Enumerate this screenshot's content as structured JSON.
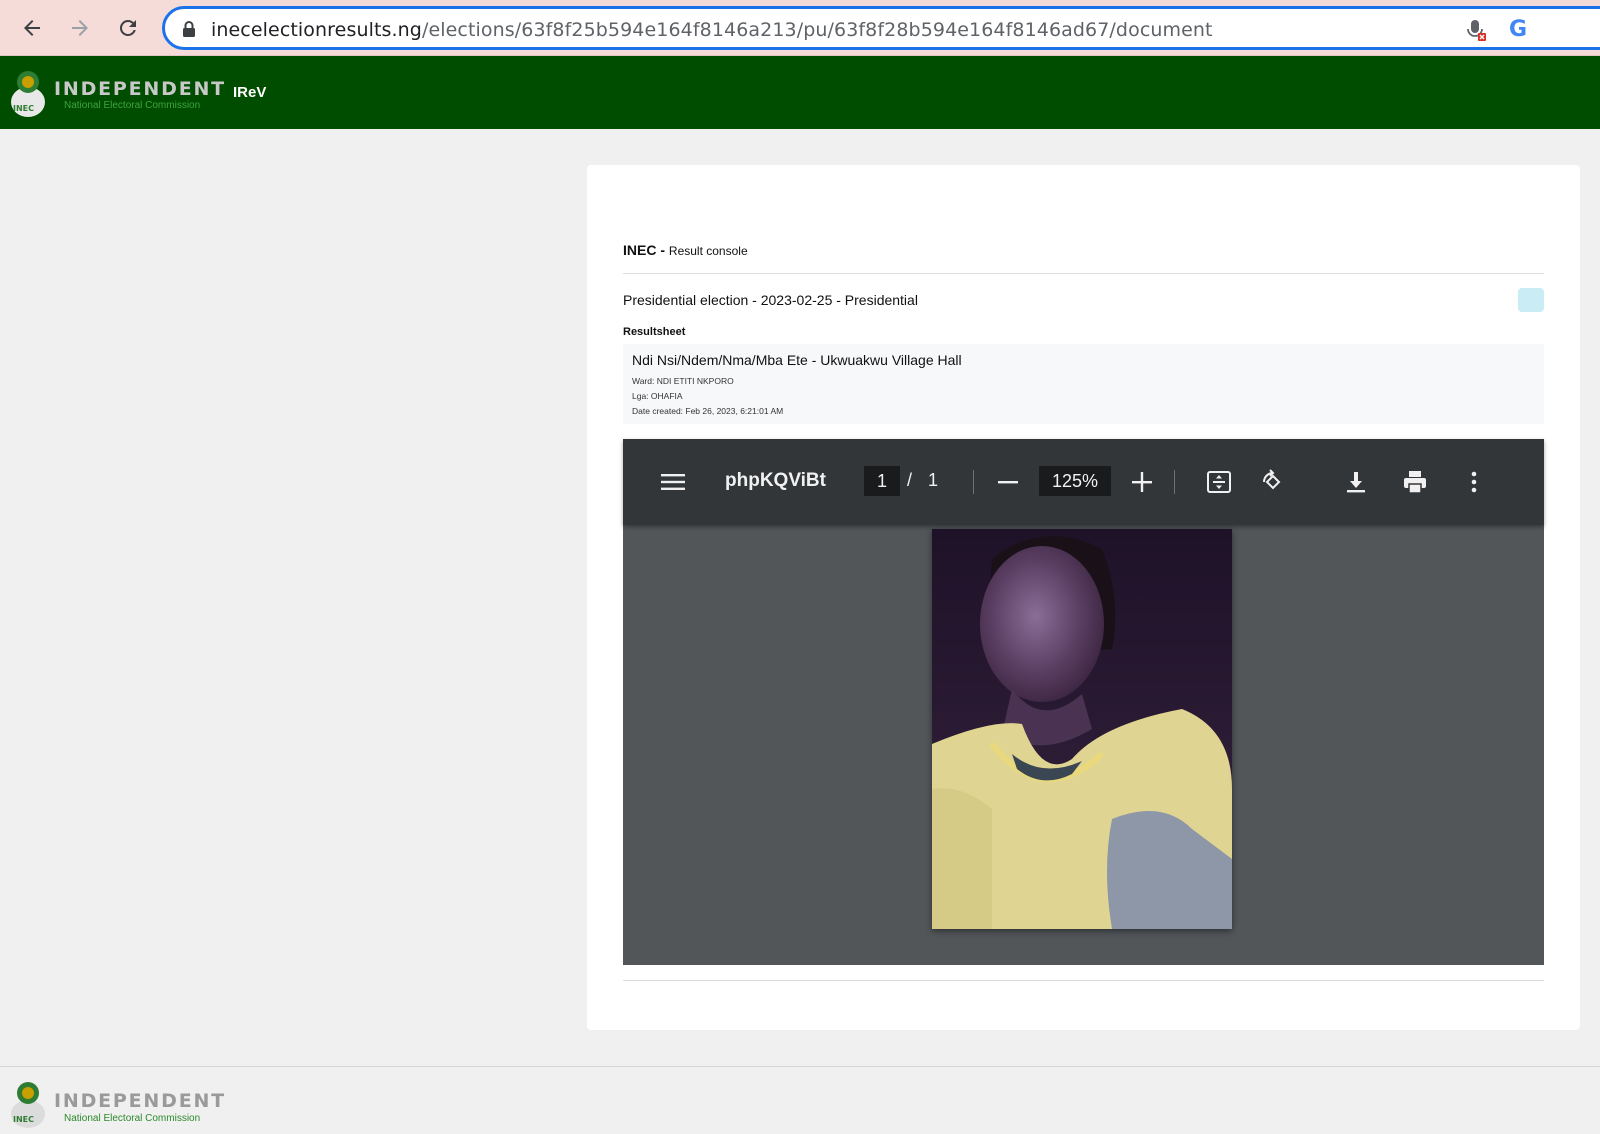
{
  "browser": {
    "url_host": "inecelectionresults.ng",
    "url_path": "/elections/63f8f25b594e164f8146a213/pu/63f8f28b594e164f8146ad67/document",
    "google_letter": "G"
  },
  "header": {
    "brand_title": "INDEPENDENT",
    "brand_subtitle": "National Electoral Commission",
    "nav_link": "IReV"
  },
  "console": {
    "org": "INEC",
    "separator": " - ",
    "title": "Result console"
  },
  "election": {
    "title": "Presidential election - 2023-02-25 - Presidential"
  },
  "resultsheet": {
    "label": "Resultsheet",
    "polling_unit": "Ndi Nsi/Ndem/Nma/Mba Ete - Ukwuakwu Village Hall",
    "ward": "Ward: NDI ETITI NKPORO",
    "lga": "Lga: OHAFIA",
    "date_created": "Date created: Feb 26, 2023, 6:21:01 AM"
  },
  "pdf_viewer": {
    "document_name": "phpKQViBt",
    "current_page": "1",
    "page_separator": "/",
    "total_pages": "1",
    "zoom": "125%"
  },
  "footer": {
    "brand_title": "INDEPENDENT",
    "brand_subtitle": "National Electoral Commission"
  },
  "colors": {
    "header_bg": "#004d00",
    "pdf_toolbar_bg": "#323639",
    "pdf_canvas_bg": "#525659",
    "omnibox_border": "#1a73e8",
    "status_pill": "#c9ecf5"
  }
}
